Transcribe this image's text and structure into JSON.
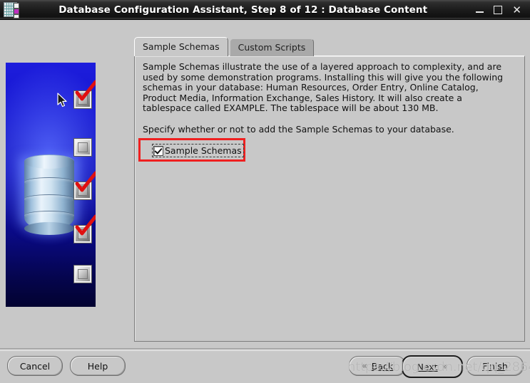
{
  "window": {
    "title": "Database Configuration Assistant, Step 8 of 12 : Database Content",
    "icon": "database-app-icon",
    "controls": {
      "minimize": "minimize-icon",
      "maximize": "maximize-icon",
      "close": "close-icon"
    }
  },
  "sidebar_graphic": {
    "name": "database-checklist-illustration",
    "cursor": "arrow-cursor",
    "checkboxes": [
      {
        "state": "checked"
      },
      {
        "state": "unchecked"
      },
      {
        "state": "checked"
      },
      {
        "state": "checked"
      },
      {
        "state": "unchecked"
      }
    ]
  },
  "tabs": [
    {
      "label": "Sample Schemas",
      "active": true
    },
    {
      "label": "Custom Scripts",
      "active": false
    }
  ],
  "panel": {
    "paragraph1": "Sample Schemas illustrate the use of a layered approach to complexity, and are used by some demonstration programs. Installing this will give you the following schemas in your database: Human Resources, Order Entry, Online Catalog, Product Media, Information Exchange, Sales History. It will also create a tablespace called EXAMPLE. The tablespace will be about 130 MB.",
    "paragraph2": "Specify whether or not to add the Sample Schemas to your database.",
    "checkbox": {
      "label": "Sample Schemas",
      "checked": true,
      "focused": true,
      "highlight_color": "#ef2020"
    }
  },
  "buttons": {
    "cancel": "Cancel",
    "help": "Help",
    "back": "Back",
    "back_icon": "«",
    "next": "Next",
    "next_icon": "»",
    "finish": "Finish",
    "default_button": "Next"
  },
  "watermark": "https://blog.csdn.net/qq_28643817",
  "colors": {
    "window_bg": "#c8c8c8",
    "titlebar": "#1c1c1c",
    "tab_active": "#c8c8c8",
    "tab_inactive": "#a9a9a9",
    "annotation_red": "#ef2020",
    "panel_blue": "#1515cf"
  }
}
